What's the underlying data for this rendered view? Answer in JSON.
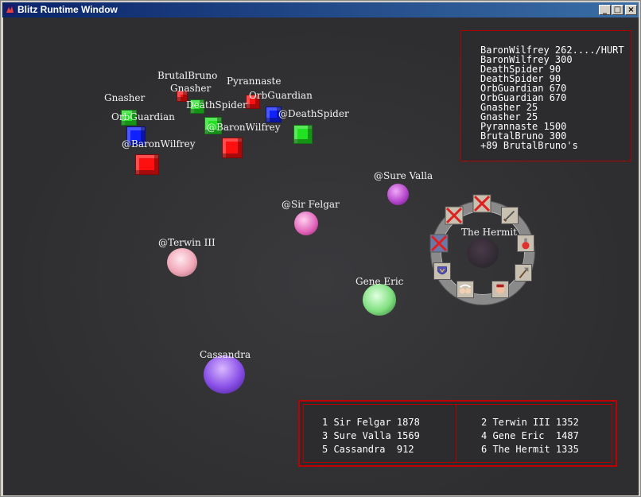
{
  "window": {
    "title": "Blitz Runtime Window",
    "minimize": "_",
    "maximize": "□",
    "close": "×"
  },
  "scene_labels": {
    "brutalbruno": "BrutalBruno",
    "gnasher_top": "Gnasher",
    "pyrannaste": "Pyrannaste",
    "gnasher_left": "Gnasher",
    "orbguardian_right": "OrbGuardian",
    "deathspider_mid": "DeathSpider",
    "orbguardian_left": "OrbGuardian",
    "at_deathspider": "@DeathSpider",
    "at_baronwilfrey_mid": "@BaronWilfrey",
    "at_baronwilfrey_left": "@BaronWilfrey",
    "sure_valla": "@Sure Valla",
    "sir_felgar": "@Sir Felgar",
    "terwin": "@Terwin III",
    "the_hermit": "The Hermit",
    "gene_eric": "Gene Eric",
    "cassandra": "Cassandra"
  },
  "log_lines": [
    "BaronWilfrey 262..../HURT",
    "BaronWilfrey 300",
    "DeathSpider 90",
    "DeathSpider 90",
    "OrbGuardian 670",
    "OrbGuardian 670",
    "Gnasher 25",
    "Gnasher 25",
    "Pyrannaste 1500",
    "BrutalBruno 300",
    "+89 BrutalBruno's"
  ],
  "scores_left": [
    "1 Sir Felgar 1878",
    "3 Sure Valla 1569",
    "5 Cassandra  912"
  ],
  "scores_right": [
    "2 Terwin III 1352",
    "4 Gene Eric  1487",
    "6 The Hermit 1335"
  ],
  "ring_menu_icons": [
    "sword-icon",
    "potion-icon",
    "axe-icon",
    "face-icon",
    "two-faces-icon",
    "shield-icon",
    "crossed-out-slot",
    "crossed-out-slot",
    "crossed-out-slot"
  ],
  "colors": {
    "enemy_red": "#ff1010",
    "enemy_green": "#22e022",
    "enemy_blue": "#1020ff",
    "panel_border": "#c00000"
  }
}
